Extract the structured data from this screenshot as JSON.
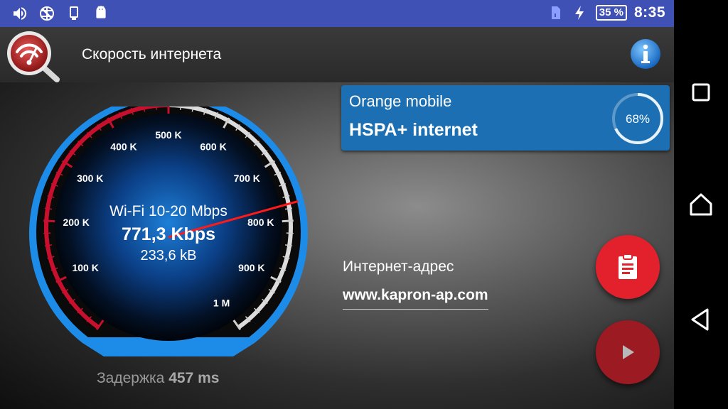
{
  "statusbar": {
    "battery": "35 %",
    "time": "8:35",
    "icons": [
      "volume-icon",
      "vpn-icon",
      "phone-icon",
      "android-icon",
      "sim-icon",
      "charging-icon"
    ]
  },
  "appbar": {
    "title": "Скорость интернета",
    "logo_icon": "wifi-speedometer-magnifier-icon",
    "info_icon": "info-icon"
  },
  "gauge": {
    "ticks": [
      "100 K",
      "200 K",
      "300 K",
      "400 K",
      "500 K",
      "600 K",
      "700 K",
      "800 K",
      "900 K",
      "1 M"
    ],
    "connection_type": "Wi-Fi  10-20 Mbps",
    "speed": "771,3 Kbps",
    "downloaded": "233,6 kB",
    "speed_kbps": 771.3
  },
  "latency": {
    "label": "Задержка",
    "value": "457 ms"
  },
  "provider": {
    "name": "Orange mobile",
    "connection": "HSPA+ internet",
    "signal_percent": "68%",
    "signal_value": 68
  },
  "ip": {
    "label": "Интернет-адрес",
    "value": "www.kapron-ap.com"
  },
  "actions": {
    "copy_icon": "clipboard-icon",
    "start_icon": "play-icon"
  },
  "colors": {
    "accent_blue": "#1b6fb2",
    "fab_red": "#e3212c",
    "statusbar": "#3f51b5",
    "needle": "#ff1a1a"
  }
}
